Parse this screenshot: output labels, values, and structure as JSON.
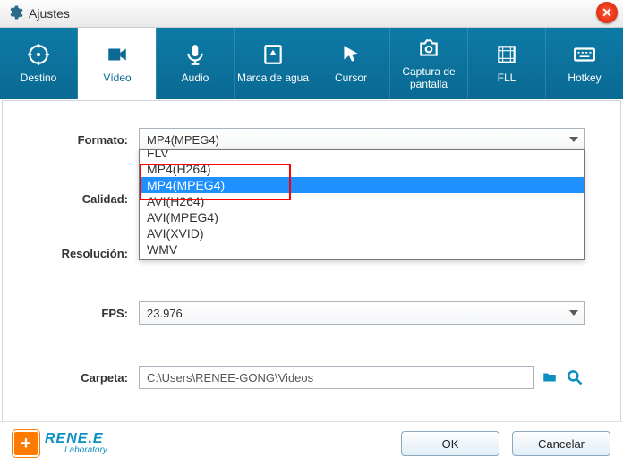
{
  "title": "Ajustes",
  "tabs": {
    "destino": "Destino",
    "video": "Vídeo",
    "audio": "Audio",
    "marca": "Marca de agua",
    "cursor": "Cursor",
    "captura": "Captura de pantalla",
    "fll": "FLL",
    "hotkey": "Hotkey"
  },
  "labels": {
    "formato": "Formato:",
    "calidad": "Calidad:",
    "resolucion": "Resolución:",
    "fps": "FPS:",
    "carpeta": "Carpeta:"
  },
  "formato": {
    "value": "MP4(MPEG4)",
    "options": [
      "FLV",
      "MP4(H264)",
      "MP4(MPEG4)",
      "AVI(H264)",
      "AVI(MPEG4)",
      "AVI(XVID)",
      "WMV"
    ]
  },
  "fps": {
    "value": "23.976"
  },
  "carpeta": {
    "value": "C:\\Users\\RENEE-GONG\\Videos"
  },
  "footer": {
    "ok": "OK",
    "cancel": "Cancelar"
  },
  "logo": {
    "main": "RENE.E",
    "sub": "Laboratory",
    "badge": "+"
  }
}
